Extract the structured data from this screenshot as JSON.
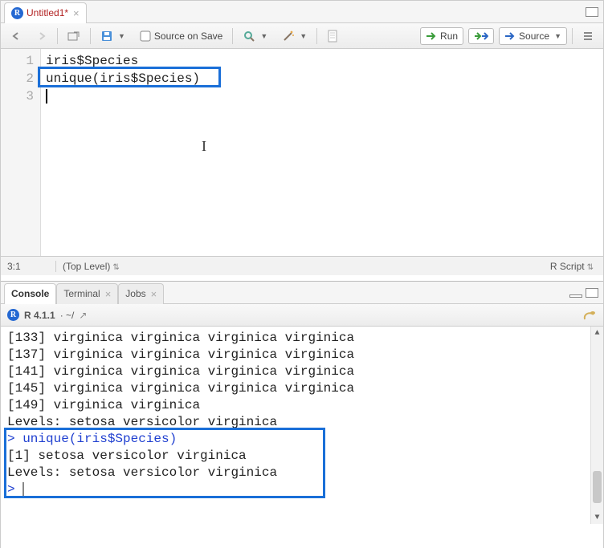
{
  "source_pane": {
    "tab": {
      "label": "Untitled1*",
      "badge": "R"
    },
    "toolbar": {
      "source_on_save": "Source on Save",
      "run": "Run",
      "source": "Source"
    },
    "code_lines": {
      "1": "iris$Species",
      "2": "unique(iris$Species)",
      "3": ""
    },
    "status": {
      "pos": "3:1",
      "scope": "(Top Level)",
      "lang": "R Script"
    }
  },
  "console_pane": {
    "tabs": {
      "console": "Console",
      "terminal": "Terminal",
      "jobs": "Jobs"
    },
    "info": {
      "badge": "R",
      "version": "R 4.1.1",
      "path": "· ~/",
      "arrow": "↗"
    },
    "output": {
      "l1": "[133] virginica  virginica  virginica  virginica ",
      "l2": "[137] virginica  virginica  virginica  virginica ",
      "l3": "[141] virginica  virginica  virginica  virginica ",
      "l4": "[145] virginica  virginica  virginica  virginica ",
      "l5": "[149] virginica  virginica",
      "l6": "Levels: setosa versicolor virginica",
      "l7_prompt": "> ",
      "l7_cmd": "unique(iris$Species)",
      "l8": "[1] setosa     versicolor virginica ",
      "l9": "Levels: setosa versicolor virginica",
      "l10_prompt": "> "
    }
  }
}
